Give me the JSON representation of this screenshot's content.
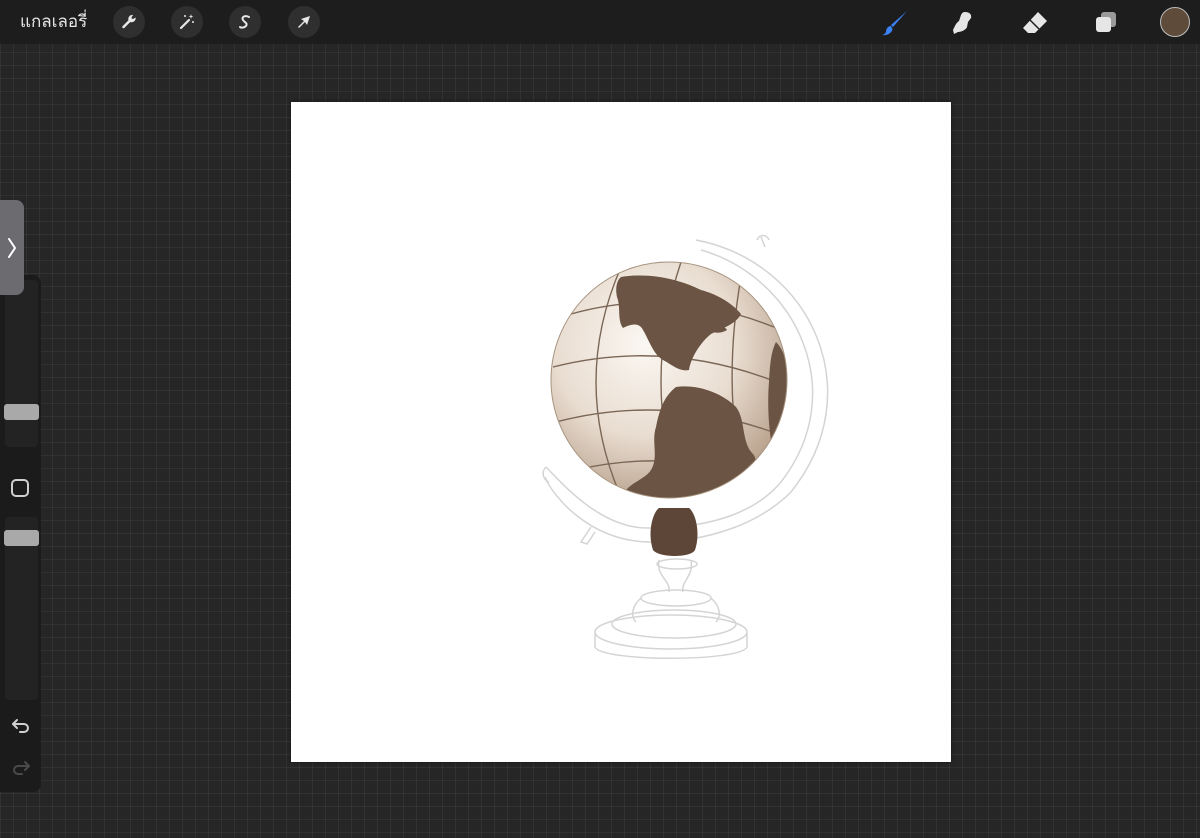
{
  "topbar": {
    "gallery_label": "แกลเลอรี่",
    "left_tools": [
      {
        "icon": "wrench-icon",
        "name": "actions-button"
      },
      {
        "icon": "magic-wand-icon",
        "name": "adjustments-button"
      },
      {
        "icon": "selection-s-icon",
        "name": "selection-button"
      },
      {
        "icon": "arrow-cursor-icon",
        "name": "transform-button"
      }
    ],
    "right_tools": [
      {
        "icon": "brush-icon",
        "name": "paint-tool-button",
        "active": true
      },
      {
        "icon": "smudge-icon",
        "name": "smudge-tool-button"
      },
      {
        "icon": "eraser-icon",
        "name": "eraser-tool-button"
      },
      {
        "icon": "layers-icon",
        "name": "layers-button"
      }
    ],
    "current_color": "#5e4b3a"
  },
  "sidebar": {
    "toggle_icon": "chevron-right-icon",
    "brush_size_level": 0.2,
    "opacity_level": 0.95,
    "modify_icon": "square-icon",
    "undo_icon": "undo-icon",
    "redo_icon": "redo-icon"
  },
  "colors": {
    "accent_blue": "#3b82f6",
    "ui_background": "#262626",
    "topbar": "#1d1d1d",
    "globe_dark": "#6b5443",
    "globe_light": "#efe6dc",
    "sketch_line": "#cfcfcf"
  }
}
